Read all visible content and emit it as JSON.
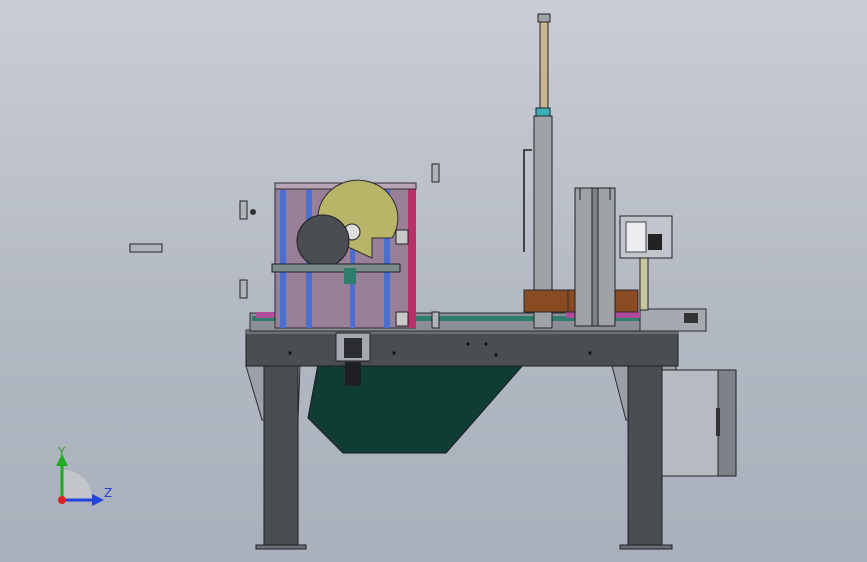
{
  "viewport": {
    "background_top": "#c9cdd4",
    "background_bottom": "#a9b0bb"
  },
  "triad": {
    "y_label": "Y",
    "z_label": "Z",
    "y_color": "#22aa22",
    "z_color": "#2244dd",
    "origin_color": "#dd2222"
  },
  "colors": {
    "frame_dark": "#4a4d52",
    "frame_mid": "#6b6f75",
    "hopper": "#0f3d33",
    "unit_panel": "#9a7f98",
    "unit_magenta": "#b8306a",
    "rod_blue": "#4a6fd0",
    "roll_khaki": "#b8b468",
    "roll_dark": "#4a4d52",
    "tower": "#9ea3a8",
    "wood": "#8a4a22",
    "cabinet": "#b8bcc2"
  }
}
